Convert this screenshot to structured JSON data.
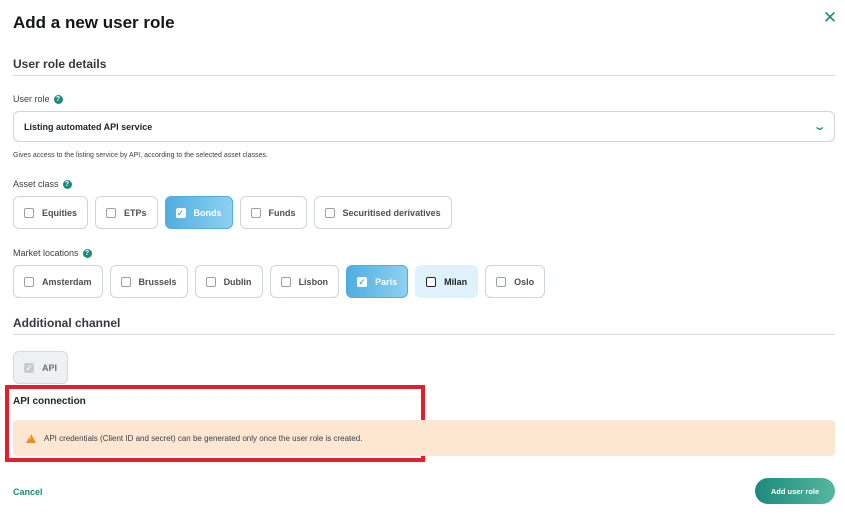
{
  "dialog": {
    "title": "Add a new user role",
    "close_icon": "close-icon"
  },
  "sections": {
    "details_title": "User role details",
    "additional_title": "Additional channel",
    "api_connection_title": "API connection"
  },
  "user_role": {
    "label": "User role",
    "selected": "Listing automated API service",
    "hint": "Gives access to the listing service by API, according to the selected asset classes."
  },
  "asset_class": {
    "label": "Asset class",
    "options": [
      {
        "label": "Equities",
        "checked": false
      },
      {
        "label": "ETPs",
        "checked": false
      },
      {
        "label": "Bonds",
        "checked": true
      },
      {
        "label": "Funds",
        "checked": false
      },
      {
        "label": "Securitised derivatives",
        "checked": false
      }
    ]
  },
  "market_locations": {
    "label": "Market locations",
    "options": [
      {
        "label": "Amsterdam",
        "checked": false
      },
      {
        "label": "Brussels",
        "checked": false
      },
      {
        "label": "Dublin",
        "checked": false
      },
      {
        "label": "Lisbon",
        "checked": false
      },
      {
        "label": "Paris",
        "checked": true
      },
      {
        "label": "Milan",
        "checked": false
      },
      {
        "label": "Oslo",
        "checked": false
      }
    ]
  },
  "additional_channel": {
    "options": [
      {
        "label": "API",
        "checked": true,
        "disabled": true
      }
    ]
  },
  "alert": {
    "text": "API credentials (Client ID and secret) can be generated only once the user role is created."
  },
  "footer": {
    "cancel_label": "Cancel",
    "submit_label": "Add user role"
  },
  "colors": {
    "accent": "#1a8b7c",
    "checked_chip": "#4faee0",
    "warning_bg": "#fde7d3",
    "warning_icon": "#f08a24",
    "highlight_border": "#e0202a"
  }
}
